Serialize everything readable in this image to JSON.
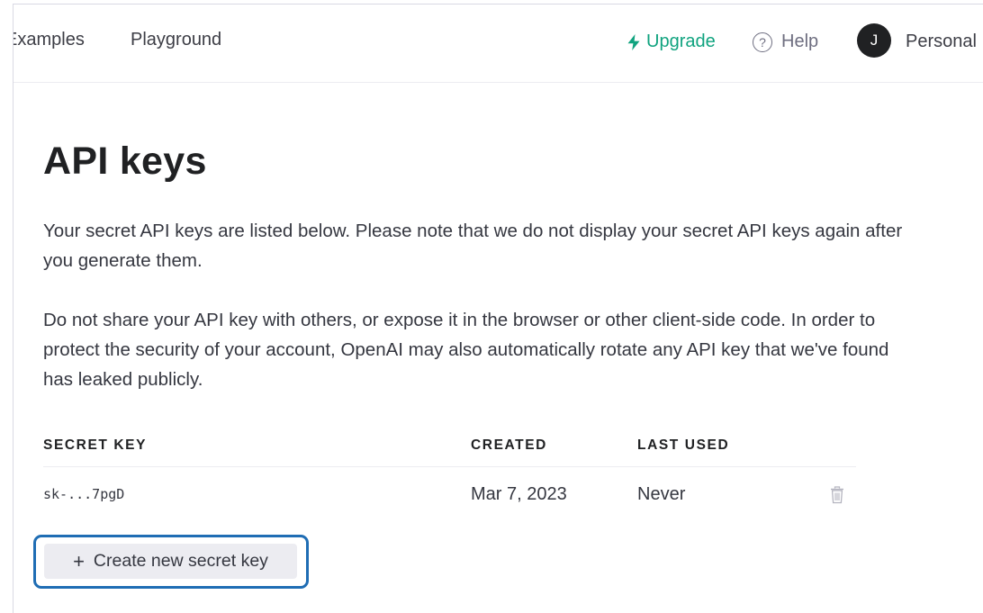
{
  "header": {
    "nav": [
      {
        "label": "Examples"
      },
      {
        "label": "Playground"
      }
    ],
    "upgrade_label": "Upgrade",
    "help_label": "Help",
    "help_icon_glyph": "?",
    "avatar_initial": "J",
    "org_label": "Personal",
    "accent_color": "#10a37f"
  },
  "main": {
    "title": "API keys",
    "paragraphs": [
      "Your secret API keys are listed below. Please note that we do not display your secret API keys again after you generate them.",
      "Do not share your API key with others, or expose it in the browser or other client-side code. In order to protect the security of your account, OpenAI may also automatically rotate any API key that we've found has leaked publicly."
    ],
    "table": {
      "headers": [
        "SECRET KEY",
        "CREATED",
        "LAST USED"
      ],
      "rows": [
        {
          "key": "sk-...7pgD",
          "created": "Mar 7, 2023",
          "last_used": "Never",
          "action_icon": "trash-icon"
        }
      ]
    },
    "create_button": {
      "icon": "+",
      "label": "Create new secret key",
      "highlight_color": "#1f6db4"
    }
  }
}
